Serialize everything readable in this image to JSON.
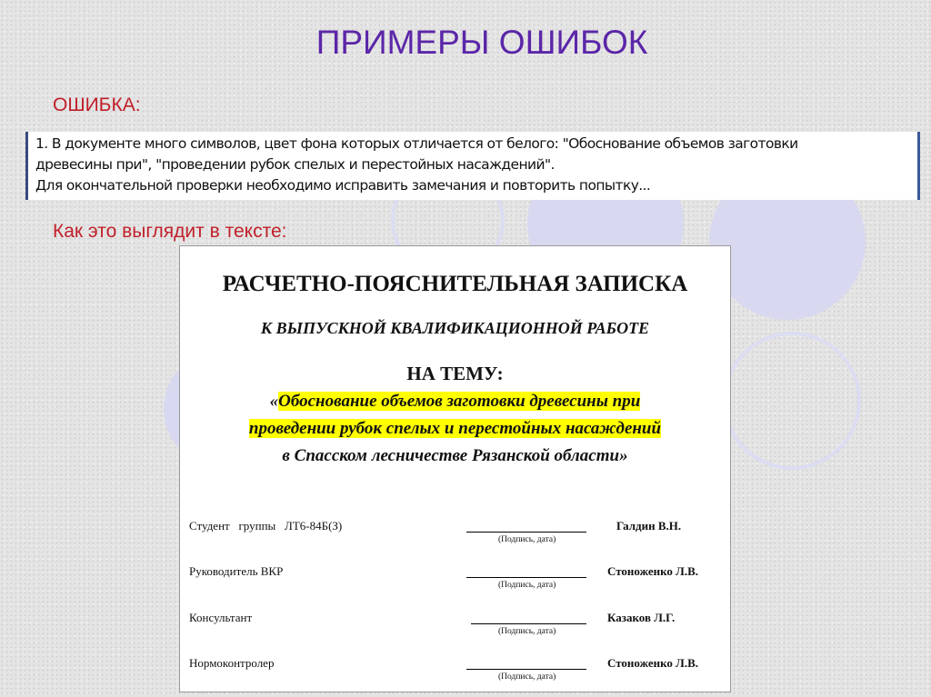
{
  "title": "ПРИМЕРЫ ОШИБОК",
  "error_label": "ОШИБКА:",
  "error_lines": [
    "1. В документе много символов, цвет фона которых отличается от белого: \"Обоснование объемов заготовки",
    "древесины при\", \"проведении рубок спелых и перестойных насаждений\".",
    "Для окончательной проверки необходимо исправить замечания и повторить попытку..."
  ],
  "look_label": "Как это выглядит в тексте:",
  "document": {
    "heading": "РАСЧЕТНО-ПОЯСНИТЕЛЬНАЯ ЗАПИСКА",
    "subheading": "К ВЫПУСКНОЙ КВАЛИФИКАЦИОННОЙ РАБОТЕ",
    "theme": "НА ТЕМУ:",
    "topic_open": "«",
    "topic_line1": "Обоснование объемов заготовки древесины при",
    "topic_line2": "проведении рубок спелых и перестойных насаждений",
    "topic_line3": "в Спасском лесничестве Рязанской области»",
    "signature_hint": "(Подпись, дата)",
    "rows": [
      {
        "role": "Студент   группы   ЛТ6-84Б(З)",
        "name": "Галдин В.Н."
      },
      {
        "role": "Руководитель ВКР",
        "name": "Стоноженко Л.В."
      },
      {
        "role": "Консультант",
        "name": "Казаков Л.Г."
      },
      {
        "role": "Нормоконтролер",
        "name": "Стоноженко Л.В."
      }
    ]
  },
  "colors": {
    "title": "#5b26a8",
    "label": "#c0202a",
    "highlight": "#ffff00"
  }
}
